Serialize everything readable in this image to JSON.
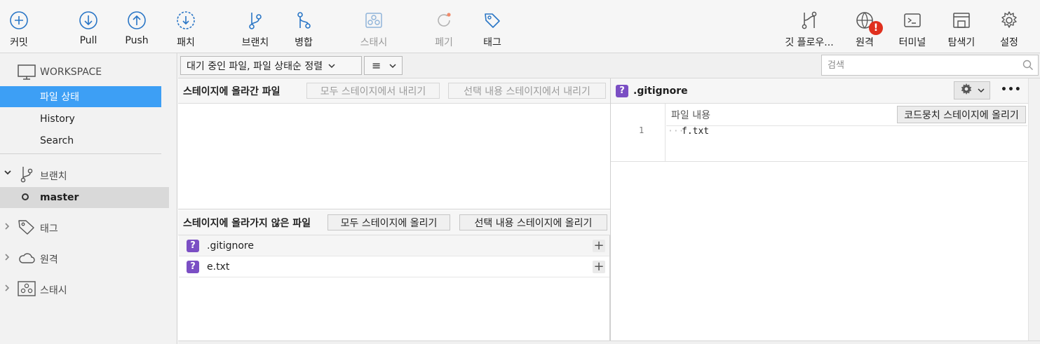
{
  "toolbar": {
    "commit": "커밋",
    "pull": "Pull",
    "push": "Push",
    "patch": "패치",
    "branch": "브랜치",
    "merge": "병합",
    "stash": "스태시",
    "discard": "폐기",
    "tag": "태그",
    "git_flow": "깃 플로우...",
    "remote": "원격",
    "remote_badge": "!",
    "terminal": "터미널",
    "explorer": "탐색기",
    "settings": "설정"
  },
  "sidebar": {
    "workspace_heading": "WORKSPACE",
    "workspace_items": [
      "파일 상태",
      "History",
      "Search"
    ],
    "branches_heading": "브랜치",
    "current_branch": "master",
    "tags_heading": "태그",
    "remotes_heading": "원격",
    "stashes_heading": "스태시"
  },
  "filter": {
    "sort_label": "대기 중인 파일, 파일 상태순 정렬",
    "view_icon": "≡",
    "search_placeholder": "검색"
  },
  "staged": {
    "title": "스테이지에 올라간 파일",
    "unstage_all": "모두 스테이지에서 내리기",
    "unstage_selected": "선택 내용 스테이지에서 내리기"
  },
  "unstaged": {
    "title": "스테이지에 올라가지 않은 파일",
    "stage_all": "모두 스테이지에 올리기",
    "stage_selected": "선택 내용 스테이지에 올리기",
    "files": [
      {
        "name": ".gitignore",
        "status": "?"
      },
      {
        "name": "e.txt",
        "status": "?"
      }
    ]
  },
  "diff": {
    "file_status": "?",
    "file_name": ".gitignore",
    "more": "•••",
    "subheader": "파일 내용",
    "stage_hunk": "코드뭉치 스테이지에 올리기",
    "line_number": "1",
    "line_prefix": "···",
    "line_text": "f.txt"
  },
  "colors": {
    "accent": "#3d9ff5",
    "untracked": "#7b4fc4",
    "badge": "#e0301e"
  }
}
